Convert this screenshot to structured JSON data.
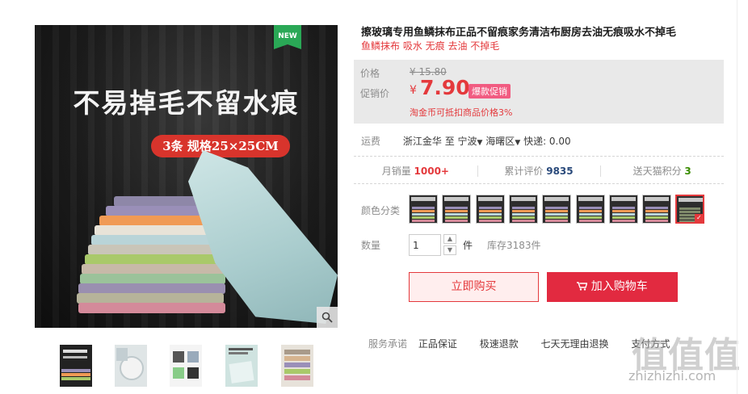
{
  "main_image": {
    "headline": "不易掉毛不留水痕",
    "spec_badge": "3条 规格25×25CM",
    "new_badge": "NEW",
    "zoom_icon": "magnifier-icon"
  },
  "product": {
    "title": "擦玻璃专用鱼鳞抹布正品不留痕家务清洁布厨房去油无痕吸水不掉毛",
    "subtitle": "鱼鳞抹布 吸水 无痕 去油 不掉毛"
  },
  "price": {
    "original_label": "价格",
    "original_value": "¥ 15.80",
    "promo_label": "促销价",
    "currency": "¥",
    "promo_value": "7.90",
    "promo_tag": "爆款促销",
    "note": "淘金币可抵扣商品价格3%"
  },
  "shipping": {
    "label": "运费",
    "from": "浙江金华",
    "to_word": "至",
    "city": "宁波",
    "district": "海曙区",
    "fee": "快递: 0.00"
  },
  "stats": {
    "monthly_label": "月销量",
    "monthly_value": "1000+",
    "reviews_label": "累计评价",
    "reviews_value": "9835",
    "points_label": "送天猫积分",
    "points_value": "3"
  },
  "color": {
    "label": "颜色分类",
    "selected_index": 8,
    "option_count": 9
  },
  "quantity": {
    "label": "数量",
    "value": "1",
    "unit": "件",
    "stock": "库存3183件"
  },
  "actions": {
    "buy_now": "立即购买",
    "add_to_cart": "加入购物车"
  },
  "service": {
    "label": "服务承诺",
    "items": [
      "正品保证",
      "极速退款",
      "七天无理由退换"
    ],
    "extra": "支付方式"
  },
  "watermark": {
    "logo": "值值值",
    "url": "zhizhizhi.com"
  },
  "colors": {
    "accent": "#e4393c",
    "cart_button": "#e22a40",
    "price_bg": "#e9e9e9"
  }
}
